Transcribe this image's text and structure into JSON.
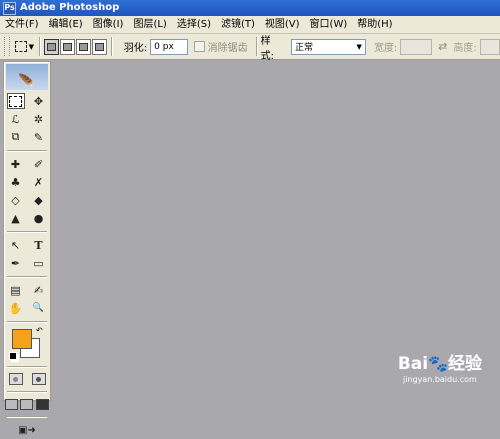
{
  "window": {
    "title": "Adobe Photoshop"
  },
  "menu": [
    "文件(F)",
    "编辑(E)",
    "图像(I)",
    "图层(L)",
    "选择(S)",
    "滤镜(T)",
    "视图(V)",
    "窗口(W)",
    "帮助(H)"
  ],
  "options": {
    "feather_label": "羽化:",
    "feather_value": "0 px",
    "antialias_label": "消除锯齿",
    "style_label": "样式:",
    "style_value": "正常",
    "width_label": "宽度:",
    "height_label": "高度:"
  },
  "toolbox": {
    "tool_glyphs": [
      [
        "▭",
        "✥"
      ],
      [
        "ℒ",
        "✲"
      ],
      [
        "⧉",
        "✎"
      ],
      [
        "✚",
        "✐"
      ],
      [
        "♣",
        "✗"
      ],
      [
        "◇",
        "◆"
      ],
      [
        "▲",
        "●"
      ],
      [
        "↖",
        "T"
      ],
      [
        "✒",
        "▭"
      ],
      [
        "▤",
        "✍"
      ],
      [
        "✋",
        "🔍"
      ]
    ],
    "foreground_color": "#f7a21b",
    "background_color": "#ffffff"
  },
  "watermark": {
    "brand": "Bai",
    "brand2": "经验",
    "url": "jingyan.baidu.com"
  }
}
